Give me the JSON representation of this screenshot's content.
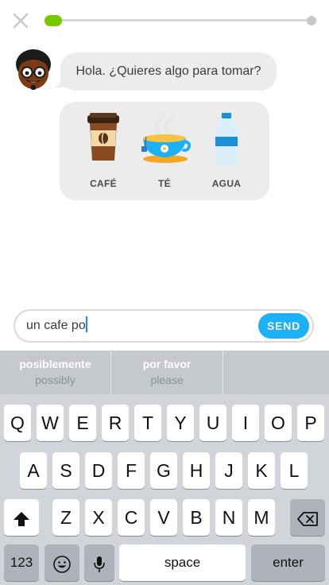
{
  "chat": {
    "prompt": "Hola. ¿Quieres algo para tomar?",
    "progress_fraction": 0.04,
    "options": [
      {
        "label": "CAFÉ",
        "icon": "coffee-cup-icon"
      },
      {
        "label": "TÉ",
        "icon": "tea-cup-icon"
      },
      {
        "label": "AGUA",
        "icon": "water-bottle-icon"
      }
    ]
  },
  "input": {
    "value": "un cafe po",
    "send_label": "SEND"
  },
  "suggestions": [
    {
      "word": "posiblemente",
      "translation": "possibly"
    },
    {
      "word": "por favor",
      "translation": "please"
    }
  ],
  "keyboard": {
    "row1": [
      "Q",
      "W",
      "E",
      "R",
      "T",
      "Y",
      "U",
      "I",
      "O",
      "P"
    ],
    "row2": [
      "A",
      "S",
      "D",
      "F",
      "G",
      "H",
      "J",
      "K",
      "L"
    ],
    "row3": [
      "Z",
      "X",
      "C",
      "V",
      "B",
      "N",
      "M"
    ],
    "numbers_label": "123",
    "space_label": "space",
    "enter_label": "enter"
  },
  "colors": {
    "accent_blue": "#1cb0f6",
    "progress_green": "#78c800",
    "bubble_gray": "#ececec"
  }
}
